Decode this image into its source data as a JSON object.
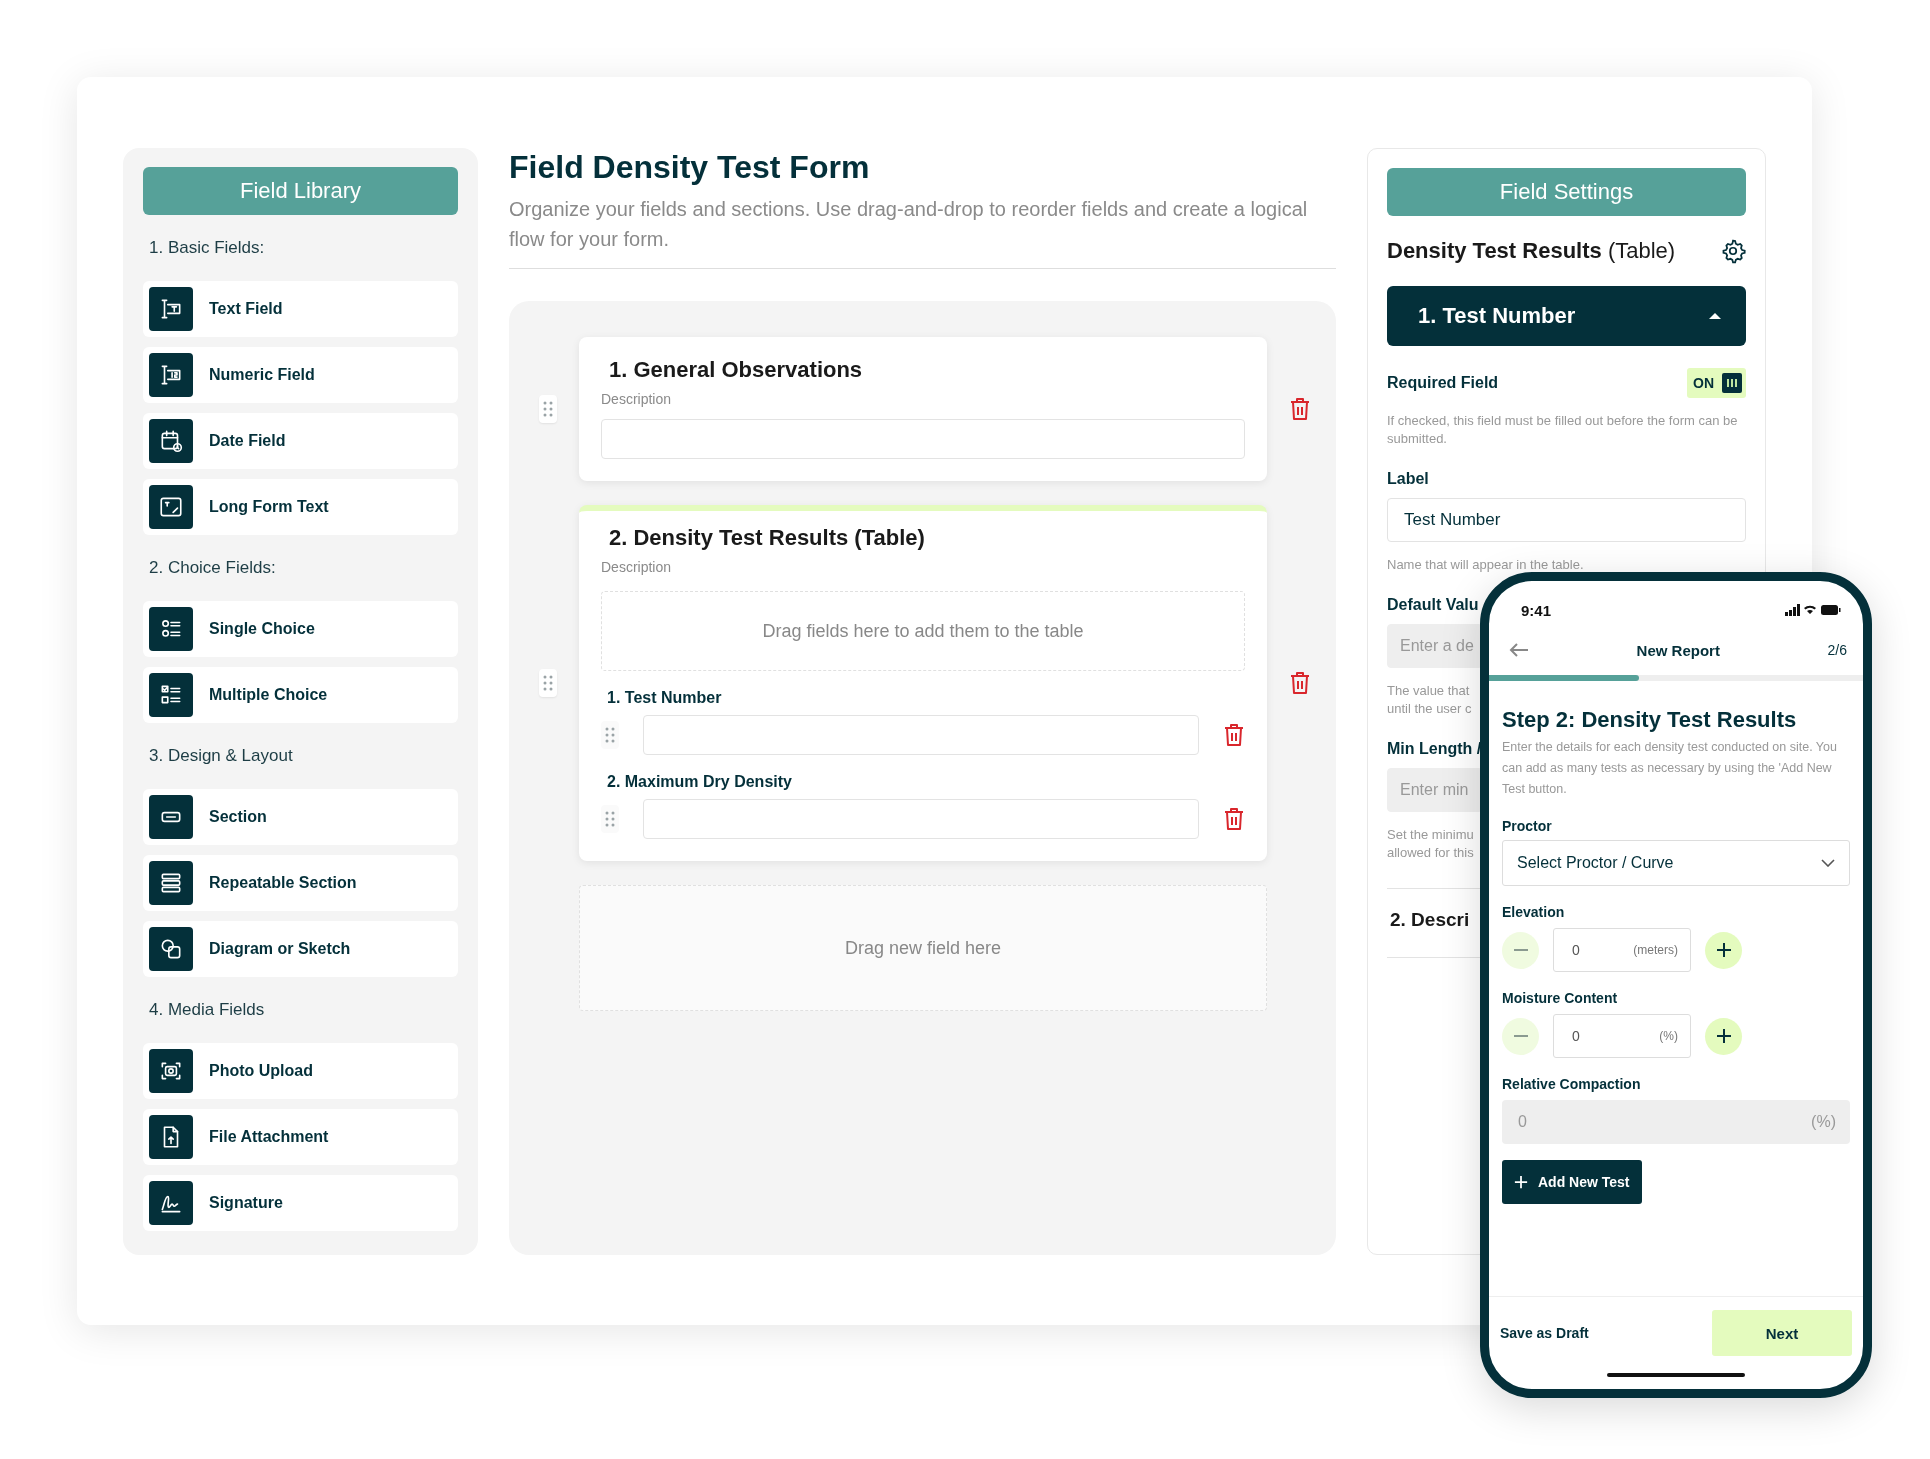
{
  "field_library": {
    "title": "Field Library",
    "groups": [
      {
        "heading": "1. Basic Fields:",
        "items": [
          {
            "label": "Text Field",
            "kind": "text"
          },
          {
            "label": "Numeric Field",
            "kind": "numeric"
          },
          {
            "label": "Date Field",
            "kind": "date"
          },
          {
            "label": "Long Form Text",
            "kind": "longtext"
          }
        ]
      },
      {
        "heading": "2. Choice Fields:",
        "items": [
          {
            "label": "Single Choice",
            "kind": "single"
          },
          {
            "label": "Multiple Choice",
            "kind": "multiple"
          }
        ]
      },
      {
        "heading": "3. Design & Layout",
        "items": [
          {
            "label": "Section",
            "kind": "section"
          },
          {
            "label": "Repeatable Section",
            "kind": "repeatable"
          },
          {
            "label": "Diagram or Sketch",
            "kind": "diagram"
          }
        ]
      },
      {
        "heading": "4. Media Fields",
        "items": [
          {
            "label": "Photo Upload",
            "kind": "photo"
          },
          {
            "label": "File Attachment",
            "kind": "file"
          },
          {
            "label": "Signature",
            "kind": "signature"
          }
        ]
      }
    ]
  },
  "form": {
    "title": "Field Density Test Form",
    "subtitle": "Organize your fields and sections. Use drag-and-drop to reorder fields and create a logical flow for your form.",
    "sections": [
      {
        "kind": "section",
        "title": "1. General Observations",
        "description_label": "Description",
        "selected": false
      },
      {
        "kind": "table",
        "title": "2. Density Test Results (Table)",
        "description_label": "Description",
        "selected": true,
        "drop_hint": "Drag fields here to add them to the table",
        "fields": [
          {
            "label": "1. Test Number"
          },
          {
            "label": "2. Maximum Dry Density"
          }
        ]
      }
    ],
    "drop_zone": "Drag new field here"
  },
  "settings": {
    "title": "Field Settings",
    "subject_name": "Density Test Results",
    "subject_type": "(Table)",
    "field": {
      "title": "1. Test Number",
      "expanded": true
    },
    "required": {
      "label": "Required Field",
      "on": true,
      "state_text": "ON",
      "help": "If checked, this field must be filled out before the form can be submitted."
    },
    "label_field": {
      "label": "Label",
      "value": "Test Number",
      "help": "Name that will appear in the table."
    },
    "default_value": {
      "label": "Default Valu",
      "placeholder": "Enter a de",
      "help": [
        "The value that",
        "until the user c"
      ]
    },
    "min_length": {
      "label": "Min Length /",
      "placeholder": "Enter min",
      "help": [
        "Set the minimu",
        "allowed for this"
      ]
    },
    "next_section": "2. Descri"
  },
  "phone": {
    "time": "9:41",
    "nav_title": "New Report",
    "step": "2/6",
    "progress": {
      "level": 0.4
    },
    "step_title": "Step 2: Density Test Results",
    "step_description": "Enter the details for each density test conducted on site. You can add as many tests as necessary by using the 'Add New Test button.",
    "fields": [
      {
        "kind": "select",
        "label": "Proctor",
        "value": "Select Proctor / Curve"
      },
      {
        "kind": "stepper",
        "label": "Elevation",
        "value": "0",
        "unit": "(meters)"
      },
      {
        "kind": "stepper",
        "label": "Moisture Content",
        "value": "0",
        "unit": "(%)"
      },
      {
        "kind": "readonly",
        "label": "Relative Compaction",
        "value": "0",
        "unit": "(%)"
      }
    ],
    "add_button": "Add New Test",
    "draft_button": "Save as Draft",
    "next_button": "Next"
  }
}
